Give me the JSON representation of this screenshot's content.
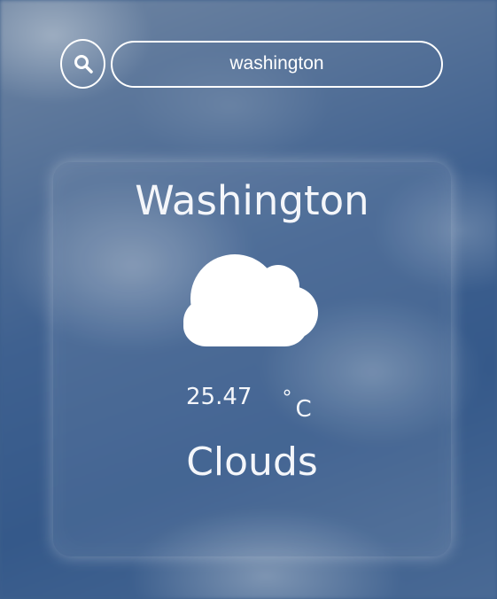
{
  "search": {
    "value": "washington",
    "icon": "search-icon"
  },
  "weather": {
    "city": "Washington",
    "icon": "cloud-icon",
    "temperature": "25.47",
    "degree_symbol": "°",
    "unit": "C",
    "condition": "Clouds"
  },
  "colors": {
    "text": "#ffffff",
    "background": "#3d5f8c"
  }
}
